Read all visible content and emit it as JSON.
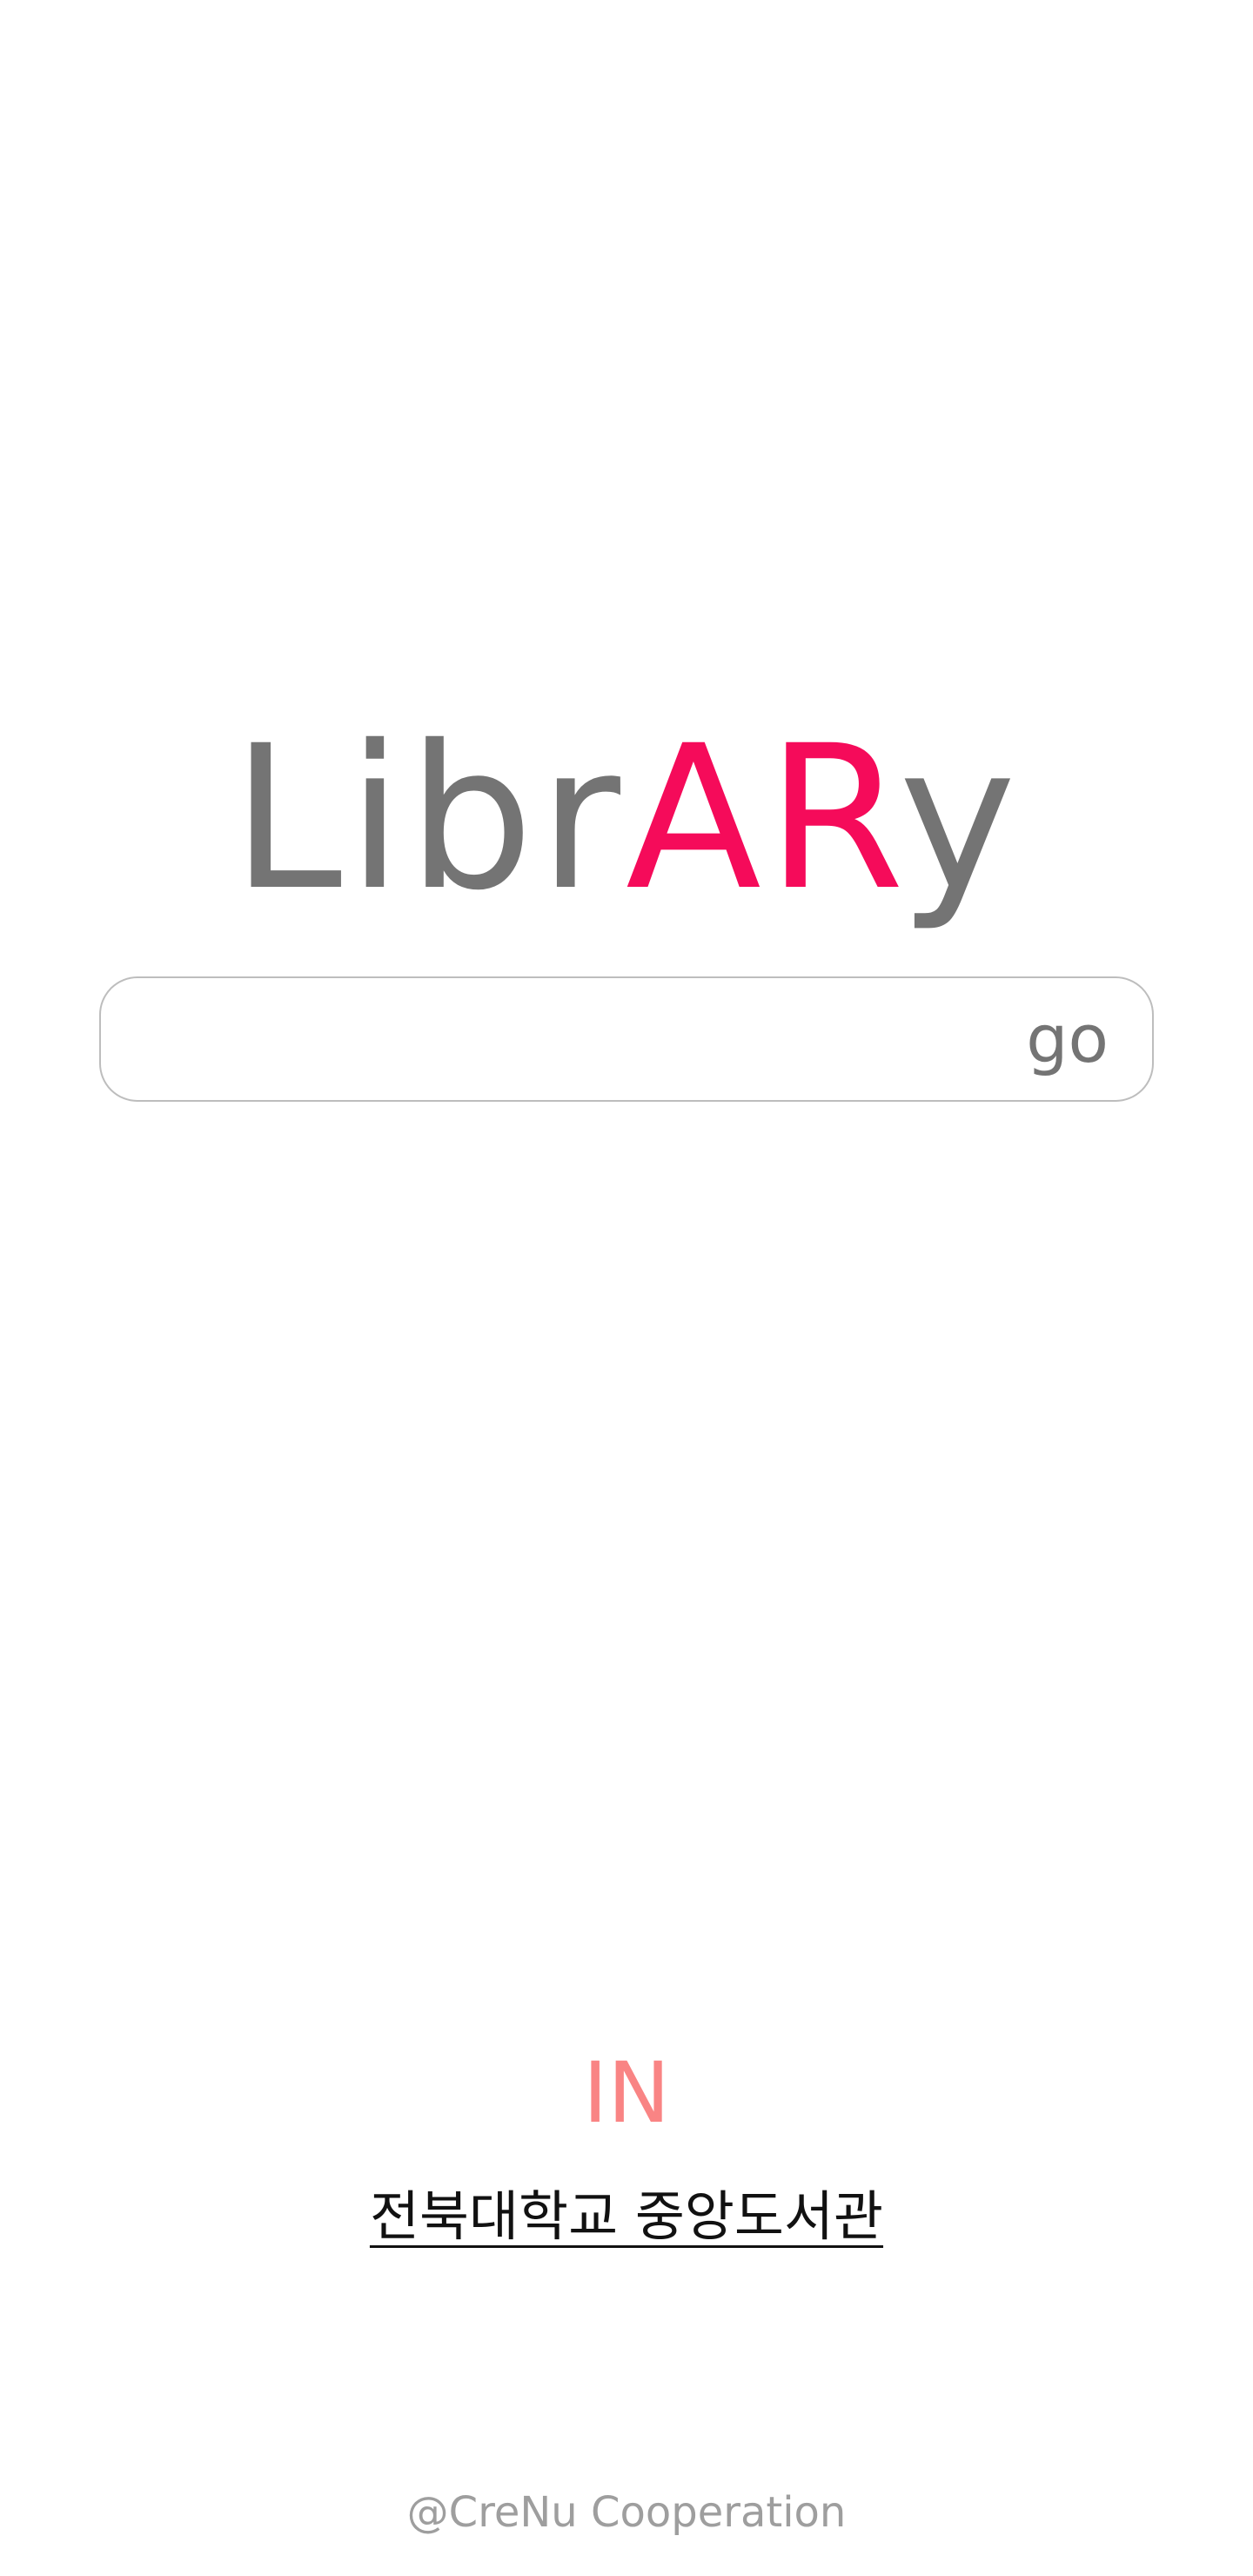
{
  "logo": {
    "part1": "Libr",
    "part2": "AR",
    "part3": "y",
    "colors": {
      "gray": "#747474",
      "accent": "#f50b5a"
    }
  },
  "search": {
    "value": "",
    "placeholder": "",
    "go_label": "go"
  },
  "location": {
    "in_label": "IN",
    "library_name": "전북대학교 중앙도서관"
  },
  "footer": {
    "credit": "@CreNu Cooperation"
  }
}
